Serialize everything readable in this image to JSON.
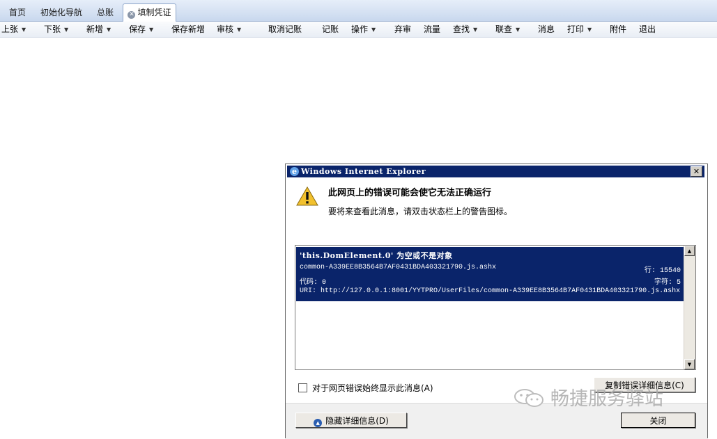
{
  "tabs": [
    {
      "label": "首页"
    },
    {
      "label": "初始化导航"
    },
    {
      "label": "总账"
    },
    {
      "label": "填制凭证",
      "active": true
    }
  ],
  "toolbar": {
    "items": [
      {
        "label": "上张",
        "dropdown": true
      },
      {
        "label": "下张",
        "dropdown": true
      },
      {
        "label": "新增",
        "dropdown": true
      },
      {
        "label": "保存",
        "dropdown": true
      },
      {
        "label": "保存新增",
        "dropdown": false
      },
      {
        "label": "审核",
        "dropdown": true
      },
      {
        "label": "取消记账",
        "dropdown": false
      },
      {
        "label": "记账",
        "dropdown": false
      },
      {
        "label": "操作",
        "dropdown": true
      },
      {
        "label": "弃审",
        "dropdown": false
      },
      {
        "label": "流量",
        "dropdown": false
      },
      {
        "label": "查找",
        "dropdown": true
      },
      {
        "label": "联查",
        "dropdown": true
      },
      {
        "label": "消息",
        "dropdown": false
      },
      {
        "label": "打印",
        "dropdown": true
      },
      {
        "label": "附件",
        "dropdown": false
      },
      {
        "label": "退出",
        "dropdown": false
      }
    ]
  },
  "dialog": {
    "title": "Windows Internet Explorer",
    "close_glyph": "✕",
    "heading": "此网页上的错误可能会使它无法正确运行",
    "subtext": "要将来查看此消息，请双击状态栏上的警告图标。",
    "details": {
      "message": "'this.DomElement.0' 为空或不是对象",
      "file": "common-A339EE8B3564B7AF0431BDA403321790.js.ashx",
      "line_label": "行: 15540",
      "code_label": "代码: 0",
      "char_label": "字符: 5",
      "uri_label": "URI: http://127.0.0.1:8001/YYTPRO/UserFiles/common-A339EE8B3564B7AF0431BDA403321790.js.ashx"
    },
    "checkbox_label": "对于网页错误始终显示此消息(A)",
    "checkbox_checked": false,
    "copy_button": "复制错误详细信息(C)",
    "hide_details_button": "隐藏详细信息(D)",
    "close_button": "关闭"
  },
  "watermark": "畅捷服务驿站",
  "icons": {
    "ie": "ie-logo-icon",
    "warning": "warning-triangle-icon",
    "tab_close": "tab-close-icon",
    "collapse": "collapse-up-icon",
    "wechat": "wechat-icon"
  },
  "colors": {
    "titlebar": "#0a246a",
    "selection": "#0a246a",
    "tabbar": "#c9d8ee",
    "warning": "#f2c12e"
  }
}
